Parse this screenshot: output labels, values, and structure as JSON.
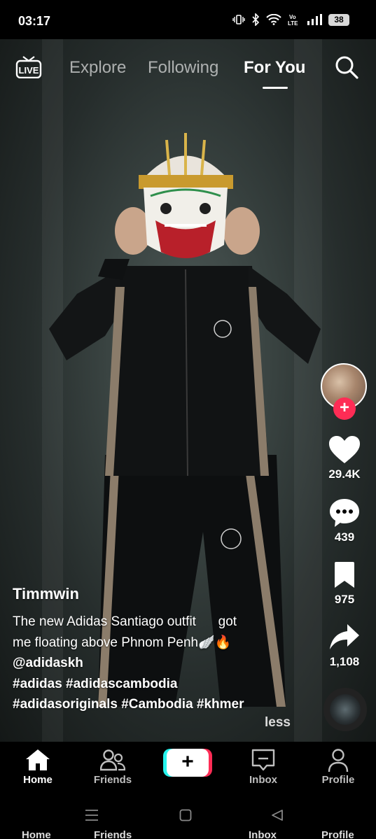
{
  "status": {
    "time": "03:17",
    "battery": "38"
  },
  "top_nav": {
    "live_label": "LIVE",
    "tabs": [
      {
        "label": "Explore",
        "active": false
      },
      {
        "label": "Following",
        "active": false
      },
      {
        "label": "For You",
        "active": true
      }
    ]
  },
  "actions": {
    "likes": "29.4K",
    "comments": "439",
    "saves": "975",
    "shares": "1,108"
  },
  "post": {
    "author": "Timmwin",
    "caption_line1": "The new Adidas Santiago outfit      got",
    "caption_line2": "me floating above Phnom Penh🪽🔥",
    "mention": "@adidaskh",
    "hashtags_line1": "#adidas #adidascambodia",
    "hashtags_line2": "#adidasoriginals #Cambodia #khmer",
    "less_label": "less"
  },
  "bottom_nav": {
    "items": [
      {
        "label": "Home",
        "active": true
      },
      {
        "label": "Friends",
        "active": false
      },
      {
        "label": "Inbox",
        "active": false
      },
      {
        "label": "Profile",
        "active": false
      }
    ]
  },
  "colors": {
    "accent": "#fe2c55",
    "cyan": "#25f4ee",
    "background": "#000000"
  }
}
